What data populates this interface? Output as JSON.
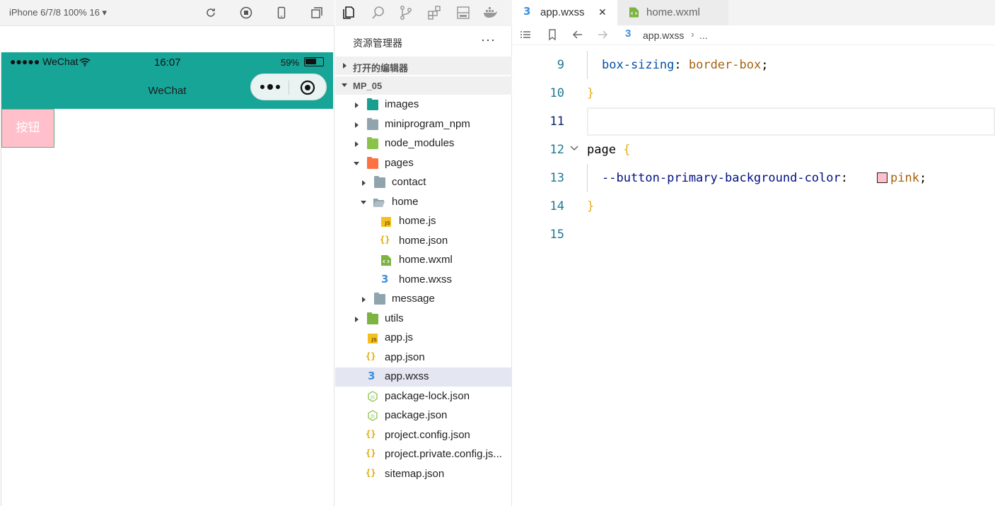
{
  "simulator": {
    "device_label": "iPhone 6/7/8 100% 16 ▾",
    "status": {
      "carrier": "●●●●● WeChat",
      "time": "16:07",
      "battery": "59%"
    },
    "nav_title": "WeChat",
    "button_label": "按钮",
    "button_color": "#ffc0cb",
    "nav_color": "#17a598"
  },
  "explorer": {
    "title": "资源管理器",
    "more": "···",
    "open_editors": "打开的编辑器",
    "project": "MP_05",
    "tree": [
      {
        "label": "images",
        "icon": "folder-images-icon"
      },
      {
        "label": "miniprogram_npm",
        "icon": "folder-icon"
      },
      {
        "label": "node_modules",
        "icon": "folder-node-icon"
      },
      {
        "label": "pages",
        "icon": "folder-pages-icon"
      },
      {
        "label": "contact",
        "icon": "folder-icon"
      },
      {
        "label": "home",
        "icon": "folder-open-icon"
      },
      {
        "label": "home.js",
        "icon": "js-file-icon"
      },
      {
        "label": "home.json",
        "icon": "json-file-icon"
      },
      {
        "label": "home.wxml",
        "icon": "wxml-file-icon"
      },
      {
        "label": "home.wxss",
        "icon": "css-file-icon"
      },
      {
        "label": "message",
        "icon": "folder-icon"
      },
      {
        "label": "utils",
        "icon": "folder-utils-icon"
      },
      {
        "label": "app.js",
        "icon": "js-file-icon"
      },
      {
        "label": "app.json",
        "icon": "json-file-icon"
      },
      {
        "label": "app.wxss",
        "icon": "css-file-icon",
        "selected": true
      },
      {
        "label": "package-lock.json",
        "icon": "npm-file-icon"
      },
      {
        "label": "package.json",
        "icon": "npm-file-icon"
      },
      {
        "label": "project.config.json",
        "icon": "json-file-icon"
      },
      {
        "label": "project.private.config.js...",
        "icon": "json-file-icon"
      },
      {
        "label": "sitemap.json",
        "icon": "json-file-icon"
      }
    ]
  },
  "editor": {
    "tabs": [
      {
        "label": "app.wxss",
        "active": true,
        "close": "✕"
      },
      {
        "label": "home.wxml",
        "active": false
      }
    ],
    "breadcrumb": {
      "file": "app.wxss",
      "sep": "›",
      "rest": "..."
    },
    "lines": [
      {
        "num": "9"
      },
      {
        "num": "10",
        "text": "}"
      },
      {
        "num": "11"
      },
      {
        "num": "12"
      },
      {
        "num": "13"
      },
      {
        "num": "14",
        "text": "}"
      },
      {
        "num": "15"
      }
    ],
    "code": {
      "l9_prop": "box-sizing",
      "l9_colon": ":",
      "l9_val": "border-box",
      "l9_semi": ";",
      "l12_sel": "page",
      "l12_brace": "{",
      "l13_var": "--button-primary-background-color",
      "l13_colon": ":",
      "l13_val": "pink",
      "l13_semi": ";",
      "swatch_color": "#ffc0cb"
    }
  }
}
